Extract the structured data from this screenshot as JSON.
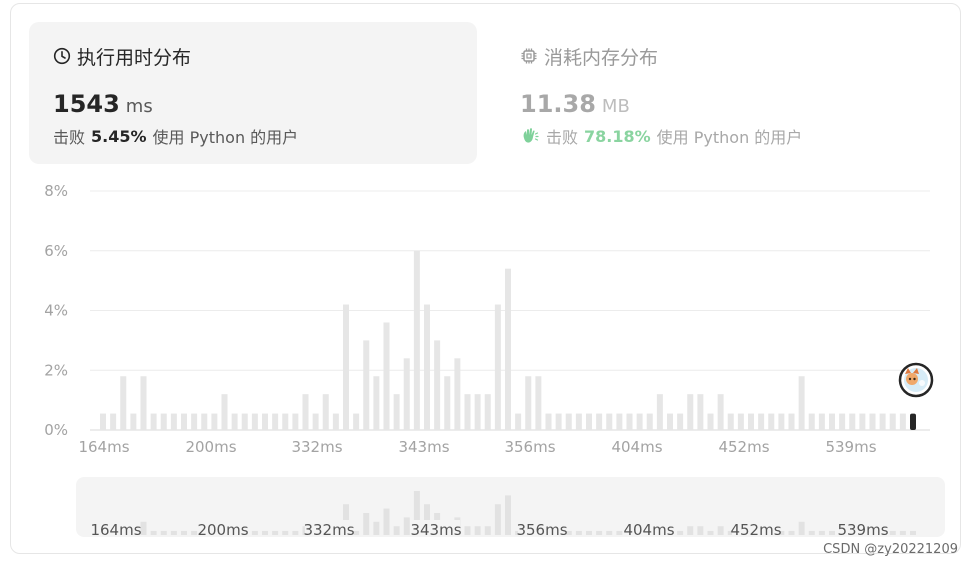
{
  "runtime": {
    "title": "执行用时分布",
    "value": "1543",
    "unit": "ms",
    "beats_prefix": "击败",
    "beats_pct": "5.45%",
    "beats_suffix": "使用 Python 的用户"
  },
  "memory": {
    "title": "消耗内存分布",
    "value": "11.38",
    "unit": "MB",
    "beats_prefix": "击败",
    "beats_pct": "78.18%",
    "beats_suffix": "使用 Python 的用户"
  },
  "chart_data": {
    "type": "bar",
    "ylabel_ticks": [
      "0%",
      "2%",
      "4%",
      "6%",
      "8%"
    ],
    "ylim": [
      0,
      8
    ],
    "grid": true,
    "x_ticks": [
      "164ms",
      "200ms",
      "332ms",
      "343ms",
      "356ms",
      "404ms",
      "452ms",
      "539ms"
    ],
    "values": [
      0.55,
      0.55,
      1.8,
      0.55,
      1.8,
      0.55,
      0.55,
      0.55,
      0.55,
      0.55,
      0.55,
      0.55,
      1.2,
      0.55,
      0.55,
      0.55,
      0.55,
      0.55,
      0.55,
      0.55,
      1.2,
      0.55,
      1.2,
      0.55,
      4.2,
      0.55,
      3.0,
      1.8,
      3.6,
      1.2,
      2.4,
      6.0,
      4.2,
      3.0,
      1.8,
      2.4,
      1.2,
      1.2,
      1.2,
      4.2,
      5.4,
      0.55,
      1.8,
      1.8,
      0.55,
      0.55,
      0.55,
      0.55,
      0.55,
      0.55,
      0.55,
      0.55,
      0.55,
      0.55,
      0.55,
      1.2,
      0.55,
      0.55,
      1.2,
      1.2,
      0.55,
      1.2,
      0.55,
      0.55,
      0.55,
      0.55,
      0.55,
      0.55,
      0.55,
      1.8,
      0.55,
      0.55,
      0.55,
      0.55,
      0.55,
      0.55,
      0.55,
      0.55,
      0.55,
      0.55,
      0.55
    ],
    "highlight_index": 80,
    "highlight_value": 0.55,
    "bar_color": "#e6e6e6",
    "highlight_color": "#262626"
  },
  "overview": {
    "x_ticks": [
      "164ms",
      "200ms",
      "332ms",
      "343ms",
      "356ms",
      "404ms",
      "452ms",
      "539ms"
    ]
  },
  "watermark": "CSDN @zy20221209"
}
